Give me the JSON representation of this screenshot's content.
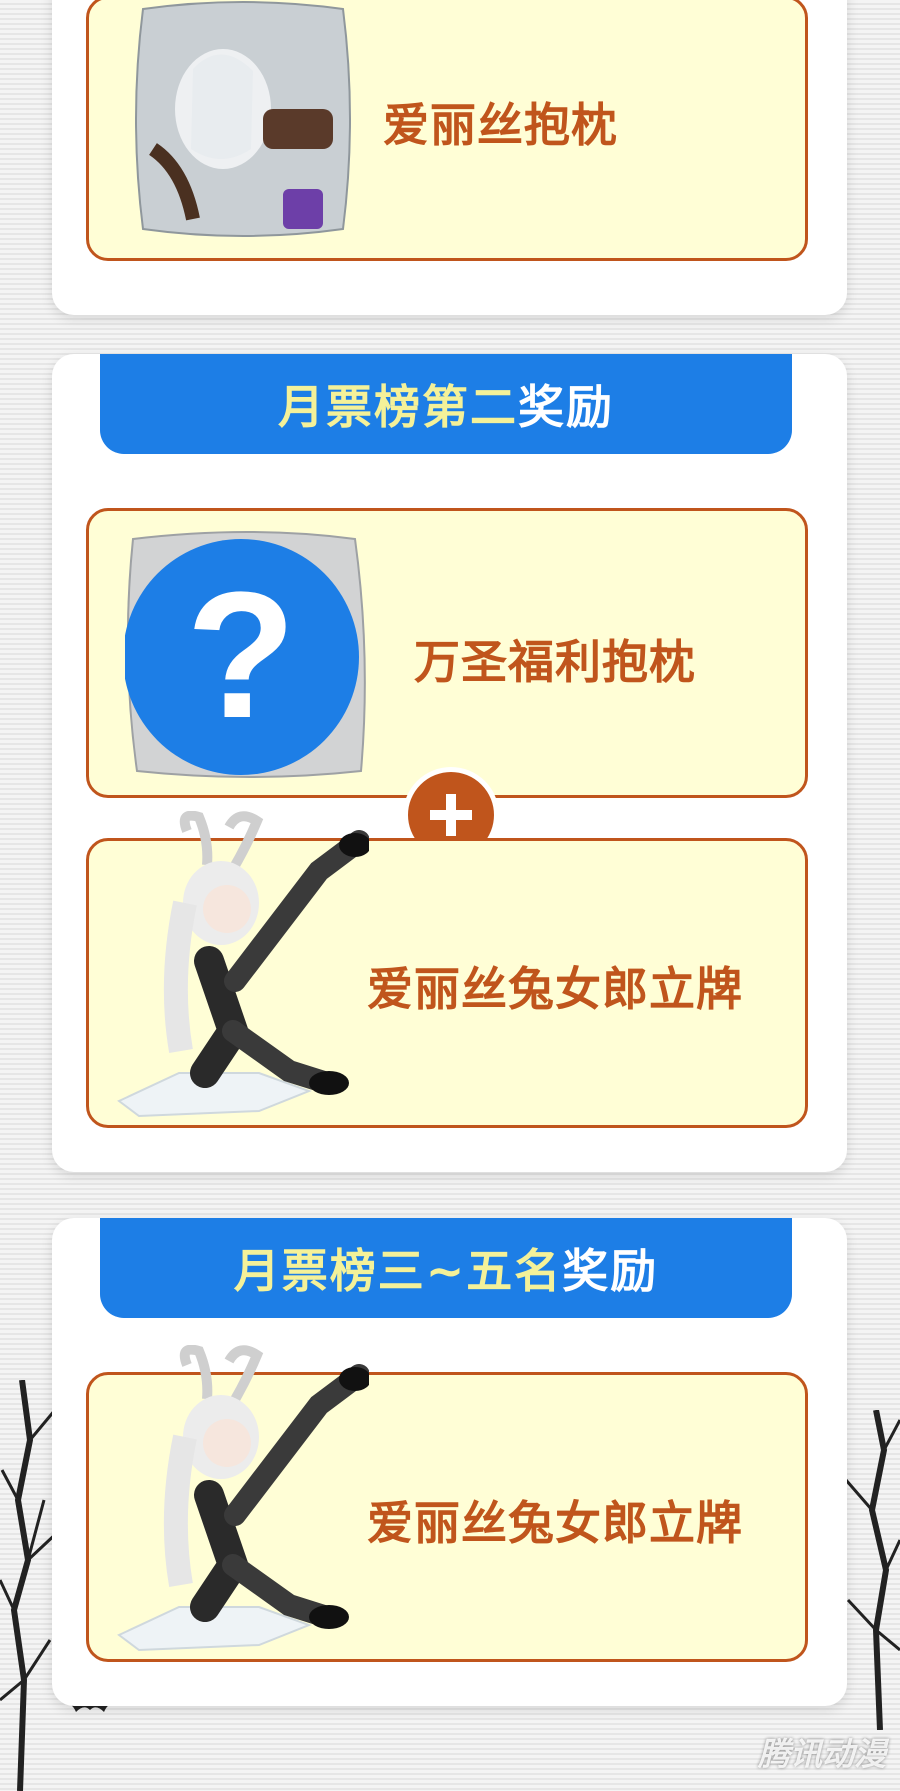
{
  "sections": [
    {
      "prizes": [
        {
          "label": "爱丽丝抱枕",
          "image_icon": "pillow-image"
        }
      ]
    },
    {
      "banner": {
        "highlight": "月票榜第二",
        "rest": "奖励"
      },
      "prizes": [
        {
          "label": "万圣福利抱枕",
          "image_icon": "mystery-question-icon"
        },
        {
          "label": "爱丽丝兔女郎立牌",
          "image_icon": "acrylic-stand-image"
        }
      ]
    },
    {
      "banner": {
        "highlight": "月票榜三~五名",
        "rest": "奖励"
      },
      "prizes": [
        {
          "label": "爱丽丝兔女郎立牌",
          "image_icon": "acrylic-stand-image"
        }
      ]
    }
  ],
  "watermark": "腾讯动漫",
  "colors": {
    "banner_bg": "#1d7ee6",
    "banner_highlight": "#f4f199",
    "prize_bg": "#fffed6",
    "prize_border": "#c0551c",
    "mystery_circle": "#1d7ee6"
  }
}
